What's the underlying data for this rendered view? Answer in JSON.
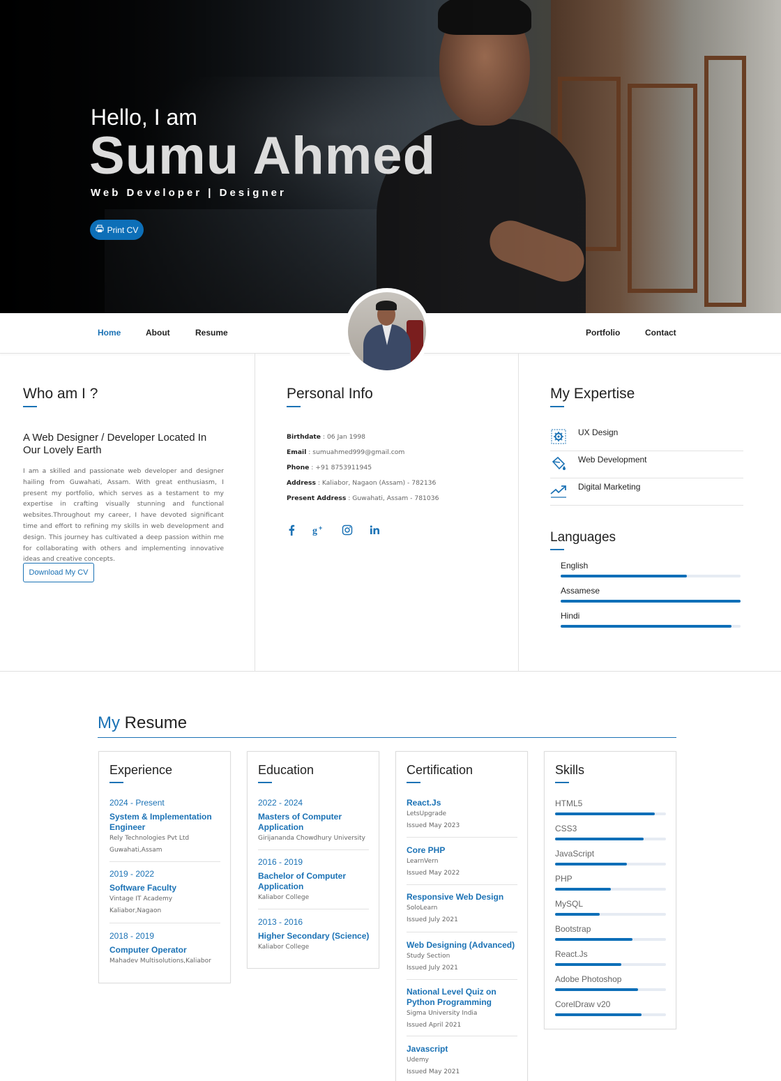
{
  "hero": {
    "greeting": "Hello, I am",
    "name": "Sumu Ahmed",
    "role": "Web Developer | Designer",
    "print_label": "Print CV"
  },
  "nav": {
    "left": [
      "Home",
      "About",
      "Resume"
    ],
    "right": [
      "Portfolio",
      "Contact"
    ],
    "active": "Home"
  },
  "who": {
    "title": "Who am I ?",
    "subtitle": "A Web Designer / Developer Located In Our Lovely Earth",
    "text": "I am a skilled and passionate web developer and designer hailing from Guwahati, Assam. With great enthusiasm, I present my portfolio, which serves as a testament to my expertise in crafting visually stunning and functional websites.Throughout my career, I have devoted significant time and effort to refining my skills in web development and design. This journey has cultivated a deep passion within me for collaborating with others and implementing innovative ideas and creative concepts.",
    "download_label": "Download My CV"
  },
  "personal": {
    "title": "Personal Info",
    "rows": [
      {
        "label": "Birthdate",
        "value": "06 Jan 1998"
      },
      {
        "label": "Email",
        "value": "sumuahmed999@gmail.com"
      },
      {
        "label": "Phone",
        "value": "+91 8753911945"
      },
      {
        "label": "Address",
        "value": "Kaliabor, Nagaon (Assam) - 782136"
      },
      {
        "label": "Present Address",
        "value": "Guwahati, Assam - 781036"
      }
    ],
    "social_icons": [
      "facebook-icon",
      "google-plus-icon",
      "instagram-icon",
      "linkedin-icon"
    ]
  },
  "expertise": {
    "title": "My Expertise",
    "items": [
      {
        "label": "UX Design",
        "icon": "gear-icon"
      },
      {
        "label": "Web Development",
        "icon": "paint-bucket-icon"
      },
      {
        "label": "Digital Marketing",
        "icon": "trending-up-icon"
      }
    ]
  },
  "languages": {
    "title": "Languages",
    "items": [
      {
        "label": "English",
        "level": 0.7
      },
      {
        "label": "Assamese",
        "level": 1.0
      },
      {
        "label": "Hindi",
        "level": 0.95
      }
    ]
  },
  "resume": {
    "title_accent": "My",
    "title_rest": "Resume",
    "experience": {
      "title": "Experience",
      "entries": [
        {
          "date": "2024 - Present",
          "title": "System & Implementation Engineer",
          "lines": [
            "Rely Technologies Pvt Ltd",
            "Guwahati,Assam"
          ]
        },
        {
          "date": "2019 - 2022",
          "title": "Software Faculty",
          "lines": [
            "Vintage IT Academy",
            "Kaliabor,Nagaon"
          ]
        },
        {
          "date": "2018 - 2019",
          "title": "Computer Operator",
          "lines": [
            "Mahadev Multisolutions,Kaliabor"
          ]
        }
      ]
    },
    "education": {
      "title": "Education",
      "entries": [
        {
          "date": "2022 - 2024",
          "title": "Masters of Computer Application",
          "lines": [
            "Girijananda Chowdhury University"
          ]
        },
        {
          "date": "2016 - 2019",
          "title": "Bachelor of Computer Application",
          "lines": [
            "Kaliabor College"
          ]
        },
        {
          "date": "2013 - 2016",
          "title": "Higher Secondary (Science)",
          "lines": [
            "Kaliabor College"
          ]
        }
      ]
    },
    "certification": {
      "title": "Certification",
      "entries": [
        {
          "title": "React.Js",
          "lines": [
            "LetsUpgrade",
            "Issued May 2023"
          ]
        },
        {
          "title": "Core PHP",
          "lines": [
            "LearnVern",
            "Issued May 2022"
          ]
        },
        {
          "title": "Responsive Web Design",
          "lines": [
            "SoloLearn",
            "Issued July 2021"
          ]
        },
        {
          "title": "Web Designing (Advanced)",
          "lines": [
            "Study Section",
            "Issued July 2021"
          ]
        },
        {
          "title": "National Level Quiz on Python Programming",
          "lines": [
            "Sigma University India",
            "Issued April 2021"
          ]
        },
        {
          "title": "Javascript",
          "lines": [
            "Udemy",
            "Issued May 2021"
          ]
        }
      ]
    },
    "skills": {
      "title": "Skills",
      "items": [
        {
          "label": "HTML5",
          "level": 0.9
        },
        {
          "label": "CSS3",
          "level": 0.8
        },
        {
          "label": "JavaScript",
          "level": 0.65
        },
        {
          "label": "PHP",
          "level": 0.5
        },
        {
          "label": "MySQL",
          "level": 0.4
        },
        {
          "label": "Bootstrap",
          "level": 0.7
        },
        {
          "label": "React.Js",
          "level": 0.6
        },
        {
          "label": "Adobe Photoshop",
          "level": 0.75
        },
        {
          "label": "CorelDraw v20",
          "level": 0.78
        }
      ]
    }
  },
  "colors": {
    "accent": "#1b72b5",
    "bar": "#0d6fb8",
    "track": "#e6ebf3"
  }
}
